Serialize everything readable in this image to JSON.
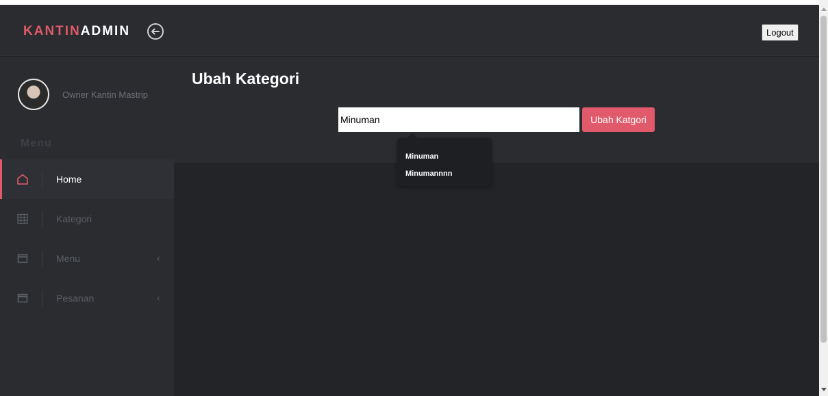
{
  "brand": {
    "part1": "KANTIN",
    "part2": "ADMIN"
  },
  "header": {
    "logout_label": "Logout"
  },
  "sidebar": {
    "owner_name": "Owner Kantin Mastrip",
    "menu_heading": "Menu",
    "items": [
      {
        "label": "Home",
        "icon": "home-icon",
        "active": true,
        "has_chevron": false
      },
      {
        "label": "Kategori",
        "icon": "grid-icon",
        "active": false,
        "has_chevron": false
      },
      {
        "label": "Menu",
        "icon": "window-icon",
        "active": false,
        "has_chevron": true,
        "chevron": "‹"
      },
      {
        "label": "Pesanan",
        "icon": "window-icon",
        "active": false,
        "has_chevron": true,
        "chevron": "‹"
      }
    ]
  },
  "main": {
    "title": "Ubah Kategori",
    "input_value": "Minuman",
    "submit_label": "Ubah Katgori",
    "suggestions": [
      "Minuman",
      "Minumannnn"
    ]
  },
  "colors": {
    "accent": "#e05a6b",
    "panel": "#2a2c30",
    "background": "#222428"
  }
}
